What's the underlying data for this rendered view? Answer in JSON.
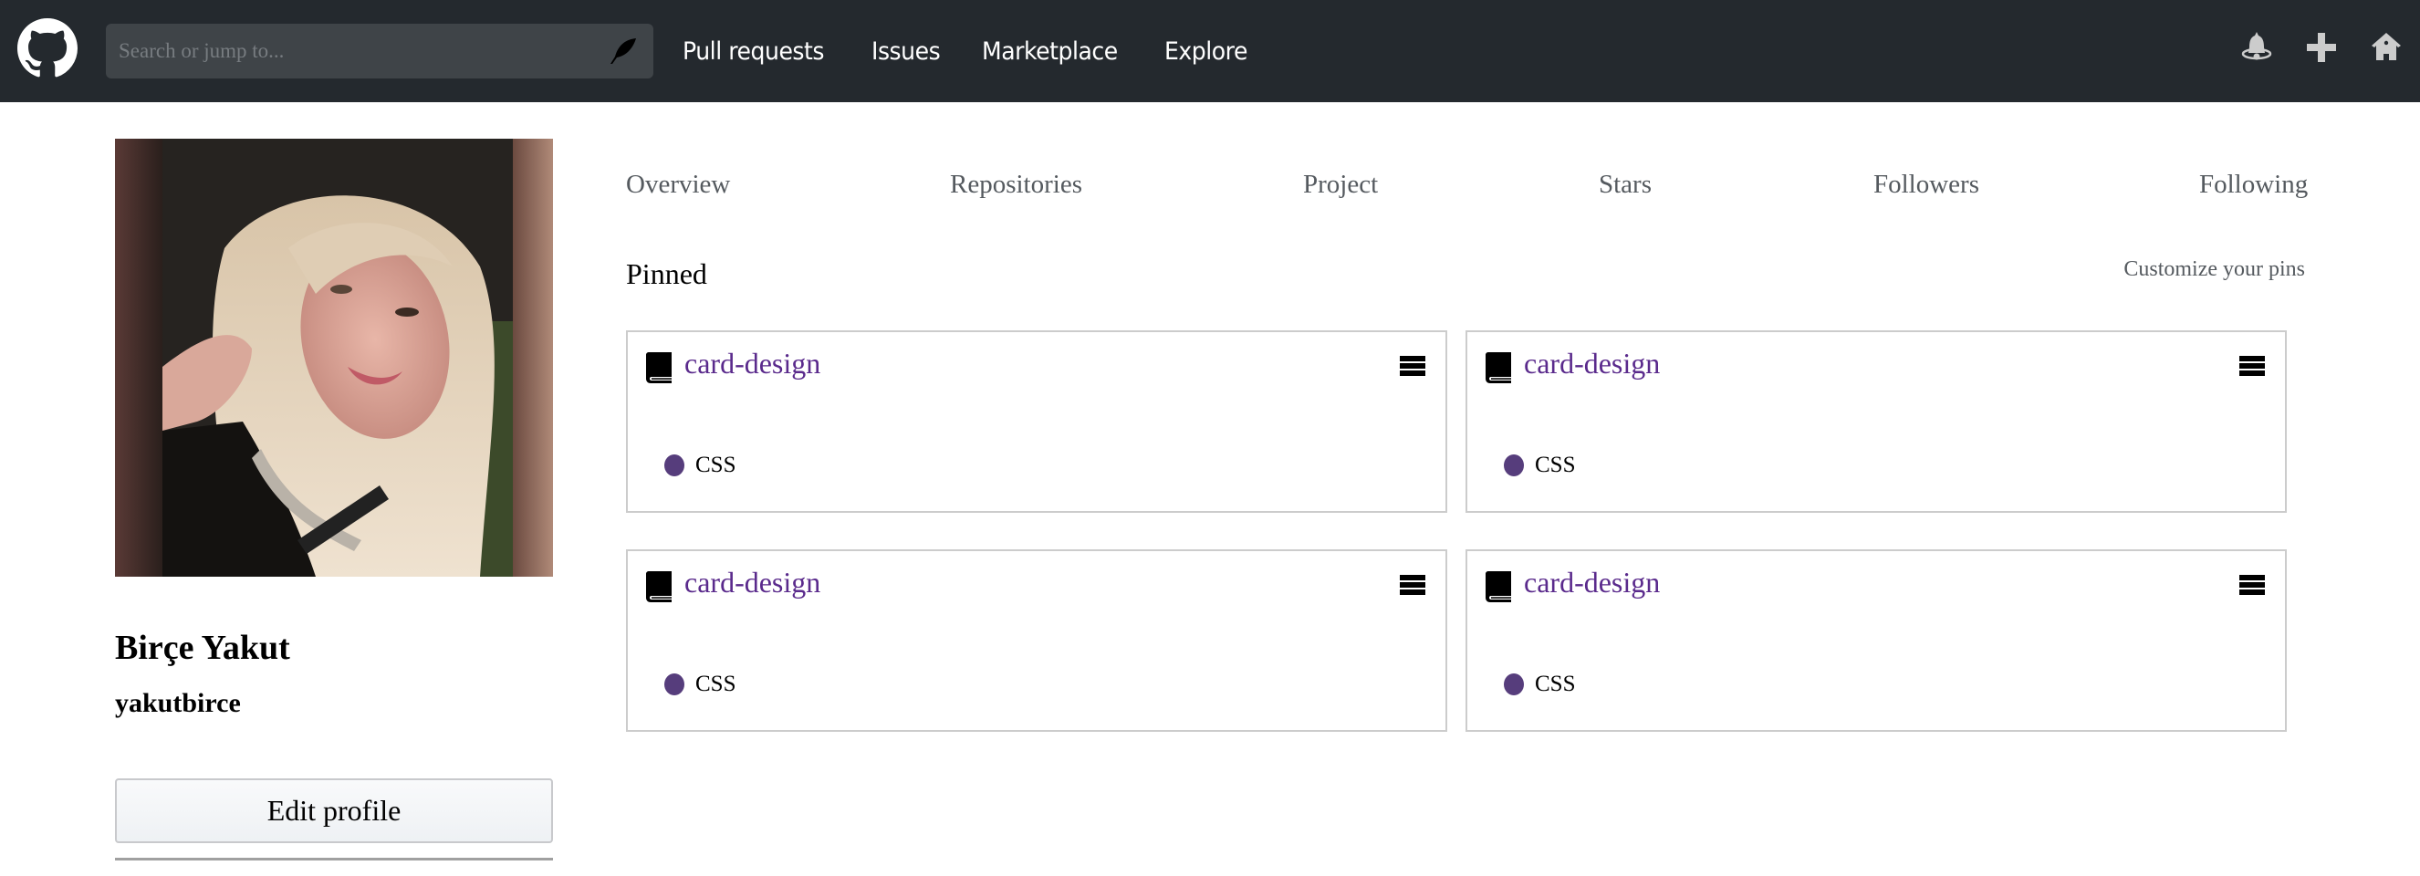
{
  "header": {
    "search_placeholder": "Search or jump to...",
    "nav": [
      "Pull requests",
      "Issues",
      "Marketplace",
      "Explore"
    ],
    "icons": [
      "bell-icon",
      "plus-icon",
      "home-icon"
    ]
  },
  "profile": {
    "full_name": "Birçe Yakut",
    "username": "yakutbirce",
    "edit_label": "Edit profile"
  },
  "tabs": [
    "Overview",
    "Repositories",
    "Project",
    "Stars",
    "Followers",
    "Following"
  ],
  "pinned": {
    "title": "Pinned",
    "customize_label": "Customize your pins",
    "cards": [
      {
        "name": "card-design",
        "language": "CSS"
      },
      {
        "name": "card-design",
        "language": "CSS"
      },
      {
        "name": "card-design",
        "language": "CSS"
      },
      {
        "name": "card-design",
        "language": "CSS"
      }
    ]
  },
  "colors": {
    "header_bg": "#24292e",
    "repo_link": "#5a2a8c",
    "css_language": "#563d7c"
  }
}
